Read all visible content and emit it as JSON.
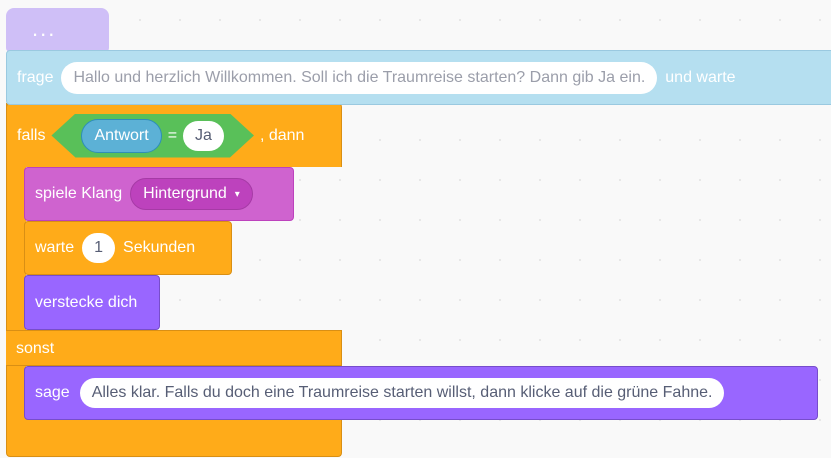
{
  "stub": {
    "label": "..."
  },
  "ask_block": {
    "label_before": "frage",
    "text": "Hallo und herzlich Willkommen. Soll ich die Traumreise starten? Dann gib Ja ein.",
    "label_after": "und warte"
  },
  "if_block": {
    "label_if": "falls",
    "reporter": "Antwort",
    "operator": "=",
    "value": "Ja",
    "label_then": ", dann",
    "label_else": "sonst"
  },
  "sound_block": {
    "label": "spiele Klang",
    "sound": "Hintergrund",
    "arrow": "▾"
  },
  "wait_block": {
    "label_before": "warte",
    "value": "1",
    "label_after": "Sekunden"
  },
  "hide_block": {
    "label": "verstecke dich"
  },
  "say_block": {
    "label": "sage",
    "text": "Alles klar. Falls du doch eine Traumreise starten willst, dann klicke auf die grüne Fahne."
  },
  "colors": {
    "control": "#ffab19",
    "sensing": "#5cb1d6",
    "operators": "#59c059",
    "sound": "#cf63cf",
    "looks": "#9966ff"
  }
}
